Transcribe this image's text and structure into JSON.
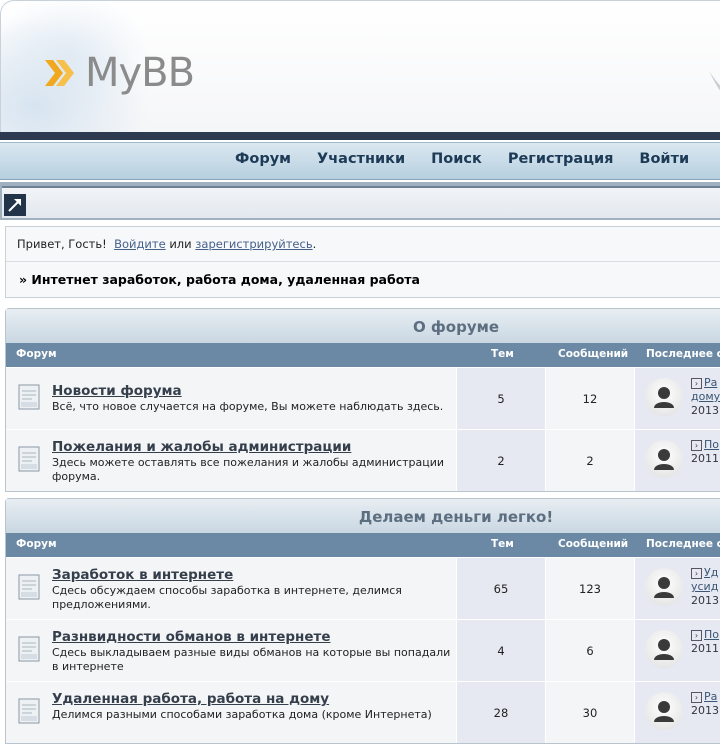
{
  "logo": {
    "text": "MyBB"
  },
  "nav": {
    "items": [
      "Форум",
      "Участники",
      "Поиск",
      "Регистрация",
      "Войти"
    ]
  },
  "welcome": {
    "greeting": "Привет, Гость!",
    "login_link": "Войдите",
    "or": "или",
    "register_link": "зарегистрируйтесь",
    "dot": "."
  },
  "breadcrumb": "» Интетнет заработок, работа дома, удаленная работа",
  "columns": {
    "forum": "Форум",
    "topics": "Тем",
    "posts": "Сообщений",
    "last": "Последнее со"
  },
  "categories": [
    {
      "title": "О форуме",
      "forums": [
        {
          "name": "Новости форума",
          "desc": "Всё, что новое случается на форуме, Вы можете наблюдать здесь.",
          "topics": "5",
          "posts": "12",
          "last_line1": "Ра",
          "last_line2": "дому",
          "last_line3": "2013"
        },
        {
          "name": "Пожелания и жалобы администрации",
          "desc": "Здесь можете оставлять все пожелания и жалобы администрации форума.",
          "topics": "2",
          "posts": "2",
          "last_line1": "По",
          "last_line2": "",
          "last_line3": "2011"
        }
      ]
    },
    {
      "title": "Делаем деньги легко!",
      "forums": [
        {
          "name": "Заработок в интернете",
          "desc": "Сдесь обсуждаем способы заработка в интернете, делимся предложениями.",
          "topics": "65",
          "posts": "123",
          "last_line1": "Уд",
          "last_line2": "усид",
          "last_line3": "2013"
        },
        {
          "name": "Разнвидности обманов в интернете",
          "desc": "Сдесь выкладываем разные виды обманов на которые вы попадали в интернете",
          "topics": "4",
          "posts": "6",
          "last_line1": "По",
          "last_line2": "",
          "last_line3": "2011"
        },
        {
          "name": "Удаленная работа, работа на дому",
          "desc": "Делимся разными способами заработка дома (кроме Интернета)",
          "topics": "28",
          "posts": "30",
          "last_line1": "Ра",
          "last_line2": "",
          "last_line3": "2013"
        }
      ]
    }
  ],
  "colors": {
    "nav_text": "#1d3a56",
    "head_bg": "#6b89a5",
    "dark_bar": "#2e3a4f"
  }
}
